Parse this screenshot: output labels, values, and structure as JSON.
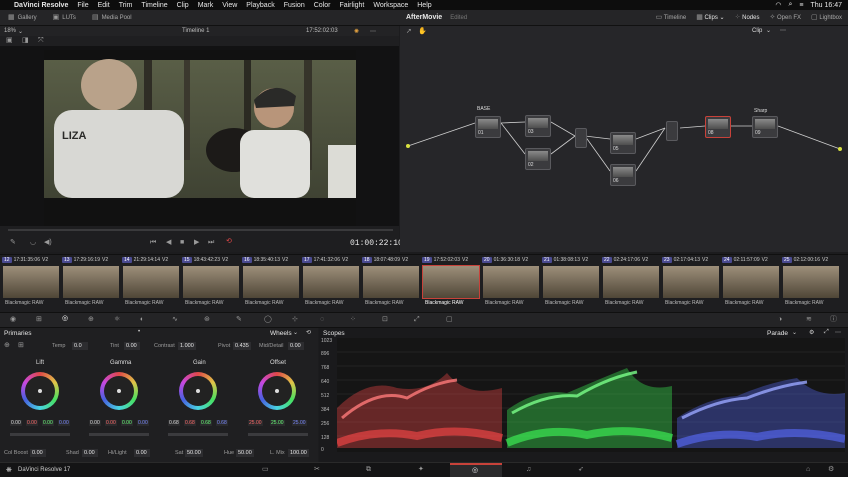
{
  "menubar": {
    "app": "DaVinci Resolve",
    "items": [
      "File",
      "Edit",
      "Trim",
      "Timeline",
      "Clip",
      "Mark",
      "View",
      "Playback",
      "Fusion",
      "Color",
      "Fairlight",
      "Workspace",
      "Help"
    ],
    "clock": "Thu 16:47"
  },
  "toolbar": {
    "gallery": "Gallery",
    "luts": "LUTs",
    "media_pool": "Media Pool",
    "project": "AfterMovie",
    "project_status": "Edited",
    "timeline_btn": "Timeline",
    "clips_btn": "Clips",
    "nodes_btn": "Nodes",
    "openfx_btn": "Open FX",
    "lightbox_btn": "Lightbox"
  },
  "viewer": {
    "zoom": "18%",
    "timeline_name": "Timeline 1",
    "timecode_top": "17:52:02:03",
    "timecode": "01:00:22:10",
    "shirt_text": "LIZA"
  },
  "nodes": {
    "mode": "Clip",
    "labels": [
      "BASE",
      "Sharp"
    ],
    "numbers": [
      "01",
      "03",
      "02",
      "05",
      "06",
      "08",
      "09"
    ]
  },
  "clips": [
    {
      "num": "12",
      "tc": "17:31:35:06",
      "track": "V2",
      "label": "Blackmagic RAW"
    },
    {
      "num": "13",
      "tc": "17:29:16:19",
      "track": "V2",
      "label": "Blackmagic RAW"
    },
    {
      "num": "14",
      "tc": "21:29:14:14",
      "track": "V2",
      "label": "Blackmagic RAW"
    },
    {
      "num": "15",
      "tc": "18:43:42:23",
      "track": "V2",
      "label": "Blackmagic RAW"
    },
    {
      "num": "16",
      "tc": "18:35:40:13",
      "track": "V2",
      "label": "Blackmagic RAW"
    },
    {
      "num": "17",
      "tc": "17:41:32:06",
      "track": "V2",
      "label": "Blackmagic RAW"
    },
    {
      "num": "18",
      "tc": "18:07:48:09",
      "track": "V2",
      "label": "Blackmagic RAW"
    },
    {
      "num": "19",
      "tc": "17:52:02:03",
      "track": "V2",
      "label": "Blackmagic RAW"
    },
    {
      "num": "20",
      "tc": "01:36:30:18",
      "track": "V2",
      "label": "Blackmagic RAW"
    },
    {
      "num": "21",
      "tc": "01:38:08:13",
      "track": "V2",
      "label": "Blackmagic RAW"
    },
    {
      "num": "22",
      "tc": "02:24:17:06",
      "track": "V2",
      "label": "Blackmagic RAW"
    },
    {
      "num": "23",
      "tc": "02:17:04:13",
      "track": "V2",
      "label": "Blackmagic RAW"
    },
    {
      "num": "24",
      "tc": "02:11:57:09",
      "track": "V2",
      "label": "Blackmagic RAW"
    },
    {
      "num": "25",
      "tc": "02:12:00:16",
      "track": "V2",
      "label": "Blackmagic RAW"
    }
  ],
  "primaries": {
    "title": "Primaries",
    "mode": "Wheels",
    "temp_label": "Temp",
    "temp": "0.0",
    "tint_label": "Tint",
    "tint": "0.00",
    "contrast_label": "Contrast",
    "contrast": "1.000",
    "pivot_label": "Pivot",
    "pivot": "0.435",
    "middetail_label": "Mid/Detail",
    "middetail": "0.00",
    "wheels": [
      {
        "name": "Lift",
        "values": [
          "0.00",
          "0.00",
          "0.00",
          "0.00"
        ]
      },
      {
        "name": "Gamma",
        "values": [
          "0.00",
          "0.00",
          "0.00",
          "0.00"
        ]
      },
      {
        "name": "Gain",
        "values": [
          "0.68",
          "0.68",
          "0.68",
          "0.68"
        ]
      },
      {
        "name": "Offset",
        "values": [
          "25.00",
          "25.00",
          "25.00"
        ]
      }
    ],
    "colboost_label": "Col Boost",
    "colboost": "0.00",
    "shad_label": "Shad",
    "shad": "0.00",
    "hilight_label": "Hi/Light",
    "hilight": "0.00",
    "sat_label": "Sat",
    "sat": "50.00",
    "hue_label": "Hue",
    "hue": "50.00",
    "lmix_label": "L. Mix",
    "lmix": "100.00"
  },
  "scopes": {
    "title": "Scopes",
    "mode": "Parade",
    "ticks": [
      "1023",
      "896",
      "768",
      "640",
      "512",
      "384",
      "256",
      "128",
      "0"
    ],
    "colors": {
      "red": "#ff4a4a",
      "green": "#3fff5a",
      "blue": "#5a6cff"
    }
  },
  "status": {
    "app_version": "DaVinci Resolve 17"
  }
}
